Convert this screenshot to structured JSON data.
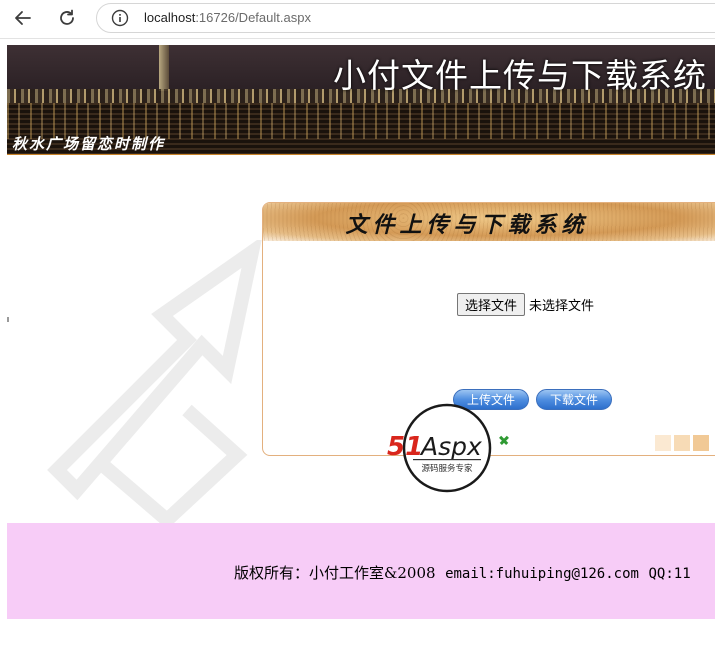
{
  "browser": {
    "url_host": "localhost",
    "url_rest": ":16726/Default.aspx"
  },
  "banner": {
    "title": "小付文件上传与下载系统",
    "credit": "秋水广场留恋时制作"
  },
  "panel": {
    "title": "文件上传与下载系统",
    "file_button_label": "选择文件",
    "file_status": "未选择文件",
    "upload_label": "上传文件",
    "download_label": "下载文件"
  },
  "logo": {
    "brand": "51Aspx",
    "tagline": "源码服务专家"
  },
  "footer": {
    "copyright": "版权所有：小付工作室&2008",
    "email": "email:fuhuiping@126.com",
    "qq": "QQ:11"
  },
  "colors": {
    "footer_bg": "#f7ccf7",
    "panel_border": "#e3b07e",
    "button_blue": "#4f8ee0",
    "logo_red": "#d9261c",
    "logo_green": "#2f9a33"
  }
}
